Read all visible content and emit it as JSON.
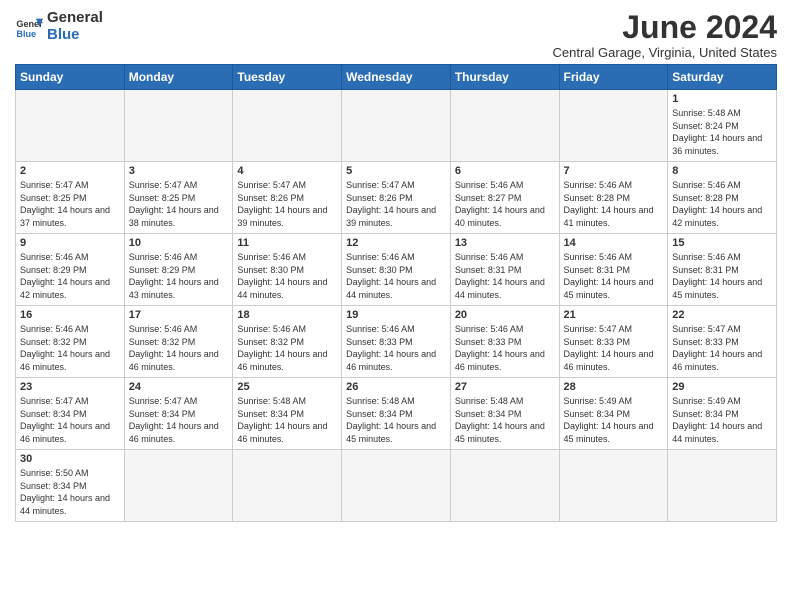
{
  "header": {
    "logo_general": "General",
    "logo_blue": "Blue",
    "month_title": "June 2024",
    "subtitle": "Central Garage, Virginia, United States"
  },
  "days_of_week": [
    "Sunday",
    "Monday",
    "Tuesday",
    "Wednesday",
    "Thursday",
    "Friday",
    "Saturday"
  ],
  "weeks": [
    [
      null,
      null,
      null,
      null,
      null,
      null,
      {
        "day": "1",
        "sunrise": "5:48 AM",
        "sunset": "8:24 PM",
        "daylight": "14 hours and 36 minutes."
      }
    ],
    [
      {
        "day": "2",
        "sunrise": "5:47 AM",
        "sunset": "8:25 PM",
        "daylight": "14 hours and 37 minutes."
      },
      {
        "day": "3",
        "sunrise": "5:47 AM",
        "sunset": "8:25 PM",
        "daylight": "14 hours and 38 minutes."
      },
      {
        "day": "4",
        "sunrise": "5:47 AM",
        "sunset": "8:26 PM",
        "daylight": "14 hours and 39 minutes."
      },
      {
        "day": "5",
        "sunrise": "5:47 AM",
        "sunset": "8:26 PM",
        "daylight": "14 hours and 39 minutes."
      },
      {
        "day": "6",
        "sunrise": "5:46 AM",
        "sunset": "8:27 PM",
        "daylight": "14 hours and 40 minutes."
      },
      {
        "day": "7",
        "sunrise": "5:46 AM",
        "sunset": "8:28 PM",
        "daylight": "14 hours and 41 minutes."
      },
      {
        "day": "8",
        "sunrise": "5:46 AM",
        "sunset": "8:28 PM",
        "daylight": "14 hours and 42 minutes."
      }
    ],
    [
      {
        "day": "9",
        "sunrise": "5:46 AM",
        "sunset": "8:29 PM",
        "daylight": "14 hours and 42 minutes."
      },
      {
        "day": "10",
        "sunrise": "5:46 AM",
        "sunset": "8:29 PM",
        "daylight": "14 hours and 43 minutes."
      },
      {
        "day": "11",
        "sunrise": "5:46 AM",
        "sunset": "8:30 PM",
        "daylight": "14 hours and 44 minutes."
      },
      {
        "day": "12",
        "sunrise": "5:46 AM",
        "sunset": "8:30 PM",
        "daylight": "14 hours and 44 minutes."
      },
      {
        "day": "13",
        "sunrise": "5:46 AM",
        "sunset": "8:31 PM",
        "daylight": "14 hours and 44 minutes."
      },
      {
        "day": "14",
        "sunrise": "5:46 AM",
        "sunset": "8:31 PM",
        "daylight": "14 hours and 45 minutes."
      },
      {
        "day": "15",
        "sunrise": "5:46 AM",
        "sunset": "8:31 PM",
        "daylight": "14 hours and 45 minutes."
      }
    ],
    [
      {
        "day": "16",
        "sunrise": "5:46 AM",
        "sunset": "8:32 PM",
        "daylight": "14 hours and 46 minutes."
      },
      {
        "day": "17",
        "sunrise": "5:46 AM",
        "sunset": "8:32 PM",
        "daylight": "14 hours and 46 minutes."
      },
      {
        "day": "18",
        "sunrise": "5:46 AM",
        "sunset": "8:32 PM",
        "daylight": "14 hours and 46 minutes."
      },
      {
        "day": "19",
        "sunrise": "5:46 AM",
        "sunset": "8:33 PM",
        "daylight": "14 hours and 46 minutes."
      },
      {
        "day": "20",
        "sunrise": "5:46 AM",
        "sunset": "8:33 PM",
        "daylight": "14 hours and 46 minutes."
      },
      {
        "day": "21",
        "sunrise": "5:47 AM",
        "sunset": "8:33 PM",
        "daylight": "14 hours and 46 minutes."
      },
      {
        "day": "22",
        "sunrise": "5:47 AM",
        "sunset": "8:33 PM",
        "daylight": "14 hours and 46 minutes."
      }
    ],
    [
      {
        "day": "23",
        "sunrise": "5:47 AM",
        "sunset": "8:34 PM",
        "daylight": "14 hours and 46 minutes."
      },
      {
        "day": "24",
        "sunrise": "5:47 AM",
        "sunset": "8:34 PM",
        "daylight": "14 hours and 46 minutes."
      },
      {
        "day": "25",
        "sunrise": "5:48 AM",
        "sunset": "8:34 PM",
        "daylight": "14 hours and 46 minutes."
      },
      {
        "day": "26",
        "sunrise": "5:48 AM",
        "sunset": "8:34 PM",
        "daylight": "14 hours and 45 minutes."
      },
      {
        "day": "27",
        "sunrise": "5:48 AM",
        "sunset": "8:34 PM",
        "daylight": "14 hours and 45 minutes."
      },
      {
        "day": "28",
        "sunrise": "5:49 AM",
        "sunset": "8:34 PM",
        "daylight": "14 hours and 45 minutes."
      },
      {
        "day": "29",
        "sunrise": "5:49 AM",
        "sunset": "8:34 PM",
        "daylight": "14 hours and 44 minutes."
      }
    ],
    [
      {
        "day": "30",
        "sunrise": "5:50 AM",
        "sunset": "8:34 PM",
        "daylight": "14 hours and 44 minutes."
      },
      null,
      null,
      null,
      null,
      null,
      null
    ]
  ]
}
